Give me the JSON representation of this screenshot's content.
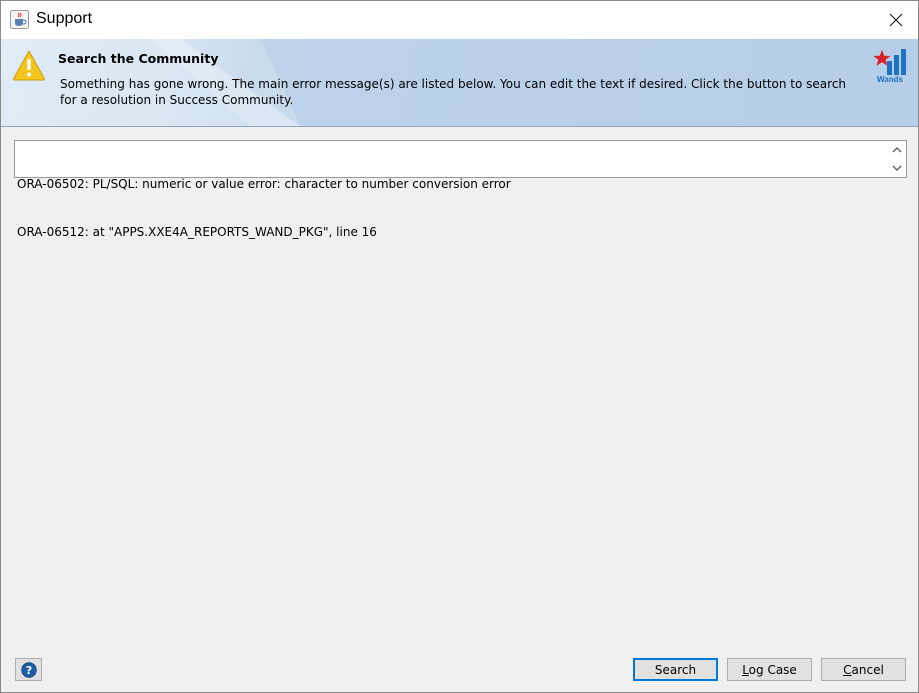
{
  "window": {
    "title": "Support",
    "app_icon": "java-cup-icon",
    "close_icon": "close-icon"
  },
  "banner": {
    "icon": "warning-icon",
    "title": "Search the Community",
    "message": "Something has gone wrong. The main error message(s) are listed below. You can edit the text if desired. Click the button to search for a resolution in Success Community.",
    "logo_text": "Wands"
  },
  "error_text": {
    "lines": [
      "ORA-06502: PL/SQL: numeric or value error: character to number conversion error",
      "ORA-06512: at \"APPS.XXE4A_REPORTS_WAND_PKG\", line 16"
    ]
  },
  "footer": {
    "help_icon": "help-icon",
    "search_label": "Search",
    "log_case_label": "Log Case",
    "log_case_mnemonic": "L",
    "log_case_rest": "og Case",
    "cancel_label": "Cancel",
    "cancel_mnemonic": "C",
    "cancel_rest": "ancel"
  },
  "colors": {
    "banner_start": "#dbe8f4",
    "banner_end": "#b6cee7",
    "warning": "#f3c61c",
    "help_blue": "#1f5fa8",
    "logo_red": "#d9222a",
    "logo_blue": "#1d72c4",
    "default_button_border": "#0078d7"
  }
}
